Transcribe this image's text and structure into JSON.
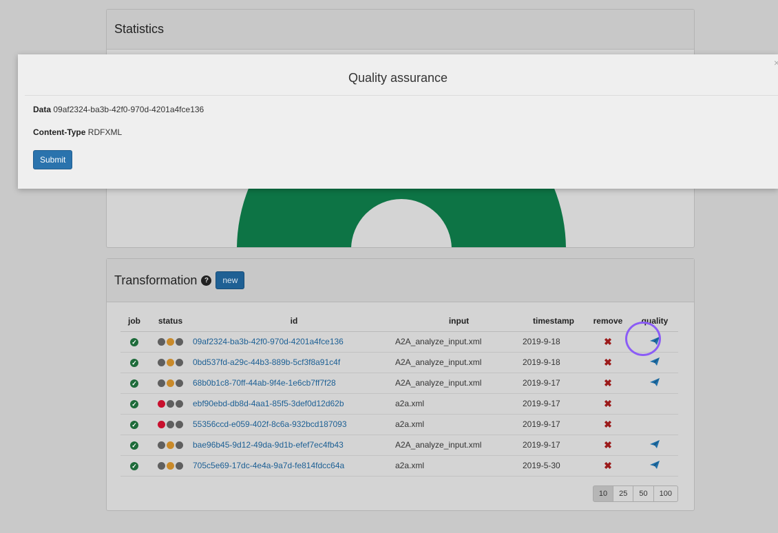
{
  "statistics": {
    "title": "Statistics",
    "gauge_color": "#0d7445"
  },
  "transformation": {
    "title": "Transformation",
    "help_glyph": "?",
    "new_label": "new",
    "columns": [
      "job",
      "status",
      "id",
      "input",
      "timestamp",
      "remove",
      "quality"
    ],
    "rows": [
      {
        "id": "09af2324-ba3b-42f0-970d-4201a4fce136",
        "input": "A2A_analyze_input.xml",
        "timestamp": "2019-9-18",
        "status": [
          "grey",
          "orange",
          "grey"
        ],
        "quality": true
      },
      {
        "id": "0bd537fd-a29c-44b3-889b-5cf3f8a91c4f",
        "input": "A2A_analyze_input.xml",
        "timestamp": "2019-9-18",
        "status": [
          "grey",
          "orange",
          "grey"
        ],
        "quality": true
      },
      {
        "id": "68b0b1c8-70ff-44ab-9f4e-1e6cb7ff7f28",
        "input": "A2A_analyze_input.xml",
        "timestamp": "2019-9-17",
        "status": [
          "grey",
          "orange",
          "grey"
        ],
        "quality": true
      },
      {
        "id": "ebf90ebd-db8d-4aa1-85f5-3def0d12d62b",
        "input": "a2a.xml",
        "timestamp": "2019-9-17",
        "status": [
          "red",
          "grey",
          "grey"
        ],
        "quality": false
      },
      {
        "id": "55356ccd-e059-402f-8c6a-932bcd187093",
        "input": "a2a.xml",
        "timestamp": "2019-9-17",
        "status": [
          "red",
          "grey",
          "grey"
        ],
        "quality": false
      },
      {
        "id": "bae96b45-9d12-49da-9d1b-efef7ec4fb43",
        "input": "A2A_analyze_input.xml",
        "timestamp": "2019-9-17",
        "status": [
          "grey",
          "orange",
          "grey"
        ],
        "quality": true
      },
      {
        "id": "705c5e69-17dc-4e4a-9a7d-fe814fdcc64a",
        "input": "a2a.xml",
        "timestamp": "2019-5-30",
        "status": [
          "grey",
          "orange",
          "grey"
        ],
        "quality": true
      }
    ],
    "page_sizes": [
      "10",
      "25",
      "50",
      "100"
    ],
    "active_page_size": "10"
  },
  "modal": {
    "title": "Quality assurance",
    "close_glyph": "×",
    "data_label": "Data",
    "data_value": "09af2324-ba3b-42f0-970d-4201a4fce136",
    "content_type_label": "Content-Type",
    "content_type_value": "RDFXML",
    "submit_label": "Submit"
  },
  "colors": {
    "ok": "#1e6b3a",
    "grey": "#5f5f5f",
    "orange": "#c98a2a",
    "red": "#c8102e",
    "link": "#1c5f94",
    "remove": "#9b1a1a",
    "quality": "#1f6fa8",
    "highlight": "#8b5cf6"
  },
  "icons": {
    "job_status": "check-circle-icon",
    "remove": "times-icon",
    "quality": "paper-plane-icon",
    "help": "question-circle-icon"
  }
}
